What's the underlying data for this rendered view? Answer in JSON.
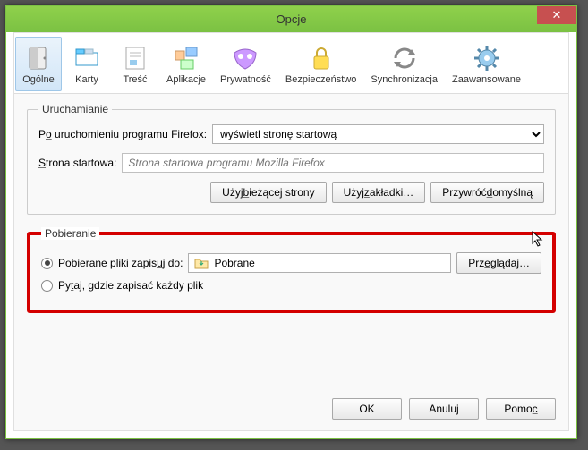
{
  "window": {
    "title": "Opcje",
    "close_label": "✕"
  },
  "tabs": [
    {
      "label": "Ogólne",
      "icon": "general"
    },
    {
      "label": "Karty",
      "icon": "tabs"
    },
    {
      "label": "Treść",
      "icon": "content"
    },
    {
      "label": "Aplikacje",
      "icon": "applications"
    },
    {
      "label": "Prywatność",
      "icon": "privacy"
    },
    {
      "label": "Bezpieczeństwo",
      "icon": "security"
    },
    {
      "label": "Synchronizacja",
      "icon": "sync"
    },
    {
      "label": "Zaawansowane",
      "icon": "advanced"
    }
  ],
  "startup": {
    "legend": "Uruchamianie",
    "on_start_label": "Po uruchomieniu programu Firefox:",
    "on_start_value": "wyświetl stronę startową",
    "homepage_label": "Strona startowa:",
    "homepage_placeholder": "Strona startowa programu Mozilla Firefox",
    "use_current": "Użyj bieżącej strony",
    "use_bookmarks": "Użyj zakładki…",
    "restore_default": "Przywróć domyślną"
  },
  "downloads": {
    "legend": "Pobieranie",
    "save_to_label": "Pobierane pliki zapisuj do:",
    "folder_name": "Pobrane",
    "browse": "Przeglądaj…",
    "ask_label": "Pytaj, gdzie zapisać każdy plik",
    "selected": "save_to"
  },
  "footer": {
    "ok": "OK",
    "cancel": "Anuluj",
    "help": "Pomoc"
  }
}
